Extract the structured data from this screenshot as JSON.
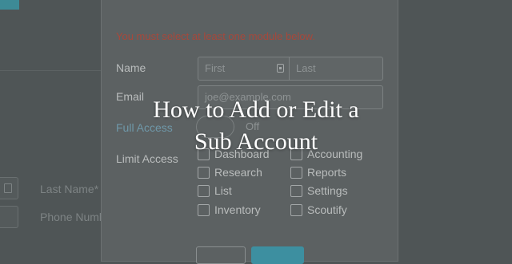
{
  "overlay_title": {
    "line1": "How to Add or Edit a",
    "line2": "Sub Account"
  },
  "background_form": {
    "last_name_label": "Last Name*",
    "phone_label": "Phone Numb"
  },
  "modal": {
    "error_message": "You must select at least one module below.",
    "name_label": "Name",
    "first_placeholder": "First",
    "last_placeholder": "Last",
    "email_label": "Email",
    "email_placeholder": "joe@example.com",
    "full_access_label": "Full Access",
    "full_access_toggle_text": "Off",
    "limit_access_label": "Limit Access",
    "modules": [
      "Dashboard",
      "Accounting",
      "Research",
      "Reports",
      "List",
      "Settings",
      "Inventory",
      "Scoutify"
    ]
  },
  "colors": {
    "accent": "#3d8fa0",
    "error": "#a7483b",
    "link": "#6f98a9"
  }
}
